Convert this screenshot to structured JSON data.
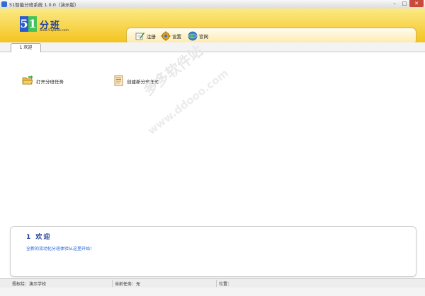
{
  "window": {
    "title": "51智能分班系统 1.0.0（演示版）",
    "buttons": {
      "minimize": "–",
      "maximize": "□",
      "close": "✕"
    }
  },
  "header": {
    "logo": {
      "digit_5": "5",
      "digit_1": "1",
      "name": "分班",
      "site": "www.51paike.com"
    },
    "toolbar": [
      {
        "label": "注册",
        "icon": "register-icon"
      },
      {
        "label": "设置",
        "icon": "settings-gear-icon"
      },
      {
        "label": "官网",
        "icon": "globe-icon"
      }
    ]
  },
  "tabs": [
    {
      "label": "1 欢迎"
    }
  ],
  "main": {
    "actions": [
      {
        "label": "打开分班任务",
        "icon": "open-folder-icon"
      },
      {
        "label": "创建新分班任务",
        "icon": "new-document-icon"
      }
    ],
    "watermark": {
      "line1": "多多软件站",
      "line2": "www.ddooo.com"
    }
  },
  "welcome": {
    "title": "1 欢迎",
    "text": "全新的流动化分班体验从这里开始！"
  },
  "status": {
    "license": "授权给：演示学校",
    "task": "当前任务：无",
    "location": "位置："
  },
  "colors": {
    "banner": "#f4c41f",
    "accent": "#1f3e9e",
    "link": "#1f5fd6"
  }
}
